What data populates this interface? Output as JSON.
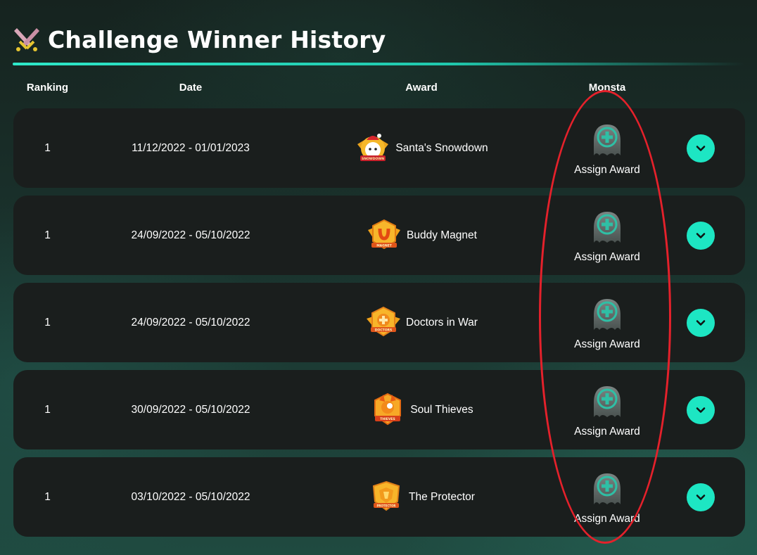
{
  "header": {
    "title": "Challenge Winner History",
    "icon": "crossed-swords-icon"
  },
  "columns": {
    "ranking": "Ranking",
    "date": "Date",
    "award": "Award",
    "monsta": "Monsta"
  },
  "colors": {
    "accent": "#1de6c3",
    "row_bg": "#1a1e1d",
    "highlight": "#e5212b"
  },
  "rows": [
    {
      "rank": "1",
      "date": "11/12/2022 - 01/01/2023",
      "award": "Santa's Snowdown",
      "badge_text": "SNOWDOWN",
      "badge_icon": "santa-badge-icon",
      "assign_label": "Assign Award"
    },
    {
      "rank": "1",
      "date": "24/09/2022 - 05/10/2022",
      "award": "Buddy Magnet",
      "badge_text": "MAGNET",
      "badge_icon": "magnet-badge-icon",
      "assign_label": "Assign Award"
    },
    {
      "rank": "1",
      "date": "24/09/2022 - 05/10/2022",
      "award": "Doctors in War",
      "badge_text": "DOCTORS",
      "badge_icon": "doctors-badge-icon",
      "assign_label": "Assign Award"
    },
    {
      "rank": "1",
      "date": "30/09/2022 - 05/10/2022",
      "award": "Soul Thieves",
      "badge_text": "THIEVES",
      "badge_icon": "thieves-badge-icon",
      "assign_label": "Assign Award"
    },
    {
      "rank": "1",
      "date": "03/10/2022 - 05/10/2022",
      "award": "The Protector",
      "badge_text": "PROTECTOR",
      "badge_icon": "protector-badge-icon",
      "assign_label": "Assign Award"
    }
  ]
}
